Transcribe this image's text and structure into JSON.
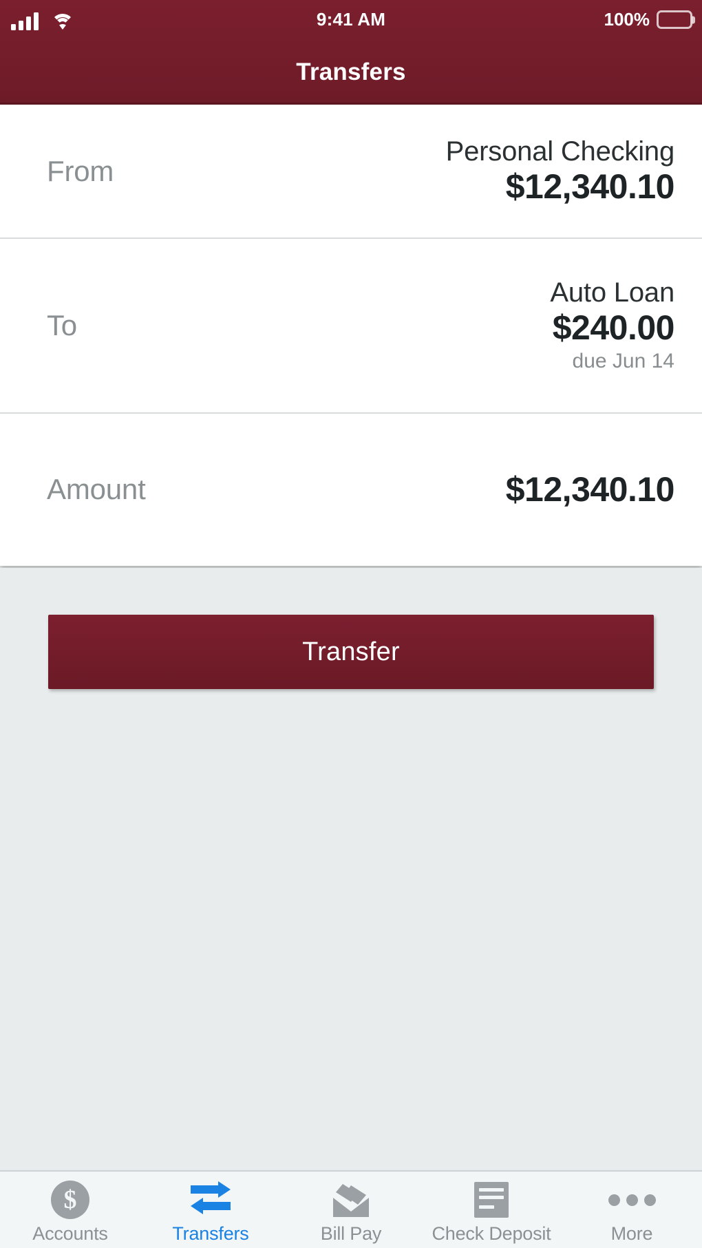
{
  "status_bar": {
    "time": "9:41 AM",
    "battery_percent": "100%",
    "signal_icon": "signal-bars-icon",
    "wifi_icon": "wifi-icon",
    "battery_icon": "battery-icon"
  },
  "header": {
    "title": "Transfers",
    "background_color": "#7b1f2e"
  },
  "form": {
    "rows": [
      {
        "label": "From",
        "account": "Personal Checking",
        "amount": "$12,340.10",
        "sub": ""
      },
      {
        "label": "To",
        "account": "Auto Loan",
        "amount": "$240.00",
        "sub": "due Jun 14"
      },
      {
        "label": "Amount",
        "account": "",
        "amount": "$12,340.10",
        "sub": ""
      }
    ]
  },
  "action": {
    "transfer_label": "Transfer",
    "button_color": "#7c1f2f"
  },
  "tabbar": {
    "active_color": "#1a82e2",
    "inactive_color": "#8b9093",
    "items": [
      {
        "label": "Accounts",
        "icon": "dollar-circle-icon",
        "active": false
      },
      {
        "label": "Transfers",
        "icon": "transfer-arrows-icon",
        "active": true
      },
      {
        "label": "Bill Pay",
        "icon": "envelope-icon",
        "active": false
      },
      {
        "label": "Check Deposit",
        "icon": "check-document-icon",
        "active": false
      },
      {
        "label": "More",
        "icon": "ellipsis-icon",
        "active": false
      }
    ]
  }
}
